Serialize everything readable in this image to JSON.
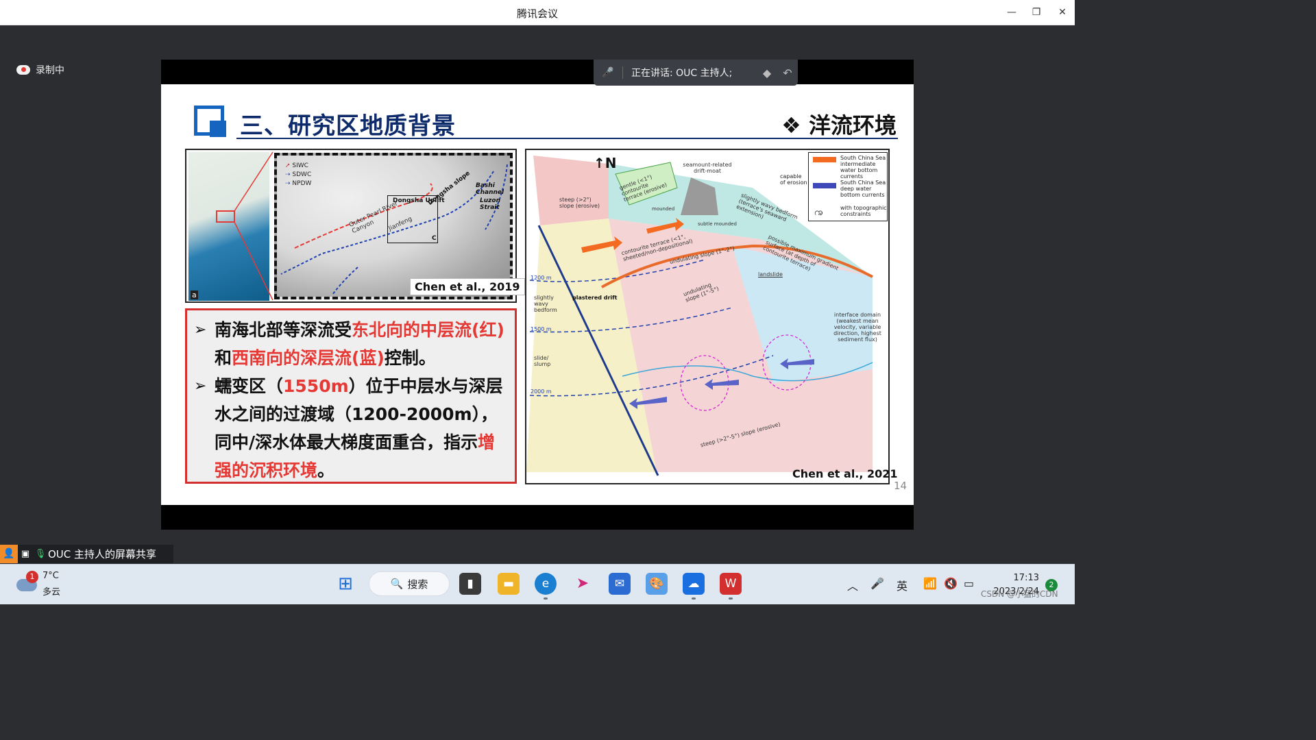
{
  "window": {
    "title": "腾讯会议",
    "minimize": "—",
    "restore": "❐",
    "close": "✕"
  },
  "recording": {
    "label": "录制中"
  },
  "speaker_bar": {
    "text": "正在讲话: OUC 主持人;"
  },
  "slide": {
    "title": "三、研究区地质背景",
    "subtitle": "❖ 洋流环境",
    "page_number": "14",
    "map": {
      "inset_label": "a",
      "legend": [
        "SIWC",
        "SDWC",
        "NPDW"
      ],
      "labels": [
        "Dongsha Uplift",
        "Dongsha slope",
        "Bashi Channel",
        "Luzon Strait",
        "Outer Pearl River Canyon",
        "Jianfeng",
        "C"
      ],
      "citation": "Chen et al., 2019"
    },
    "bullets": [
      {
        "parts": [
          {
            "text": "南海北部等深流受",
            "red": false
          },
          {
            "text": "东北向的中层流(红)",
            "red": true
          },
          {
            "text": "和",
            "red": false
          },
          {
            "text": "西南向的深层流(蓝)",
            "red": true
          },
          {
            "text": "控制。",
            "red": false
          }
        ]
      },
      {
        "parts": [
          {
            "text": "蠕变区（",
            "red": false
          },
          {
            "text": "1550m",
            "red": true
          },
          {
            "text": "）位于中层水与深层水之间的过渡域（1200-2000m），同中/深水体最大梯度面重合，指示",
            "red": false
          },
          {
            "text": "增强的沉积环境",
            "red": true
          },
          {
            "text": "。",
            "red": false
          }
        ]
      }
    ],
    "diagram": {
      "citation": "Chen et al., 2021",
      "north": "N",
      "legend": [
        "South China Sea intermediate water bottom currents",
        "South China Sea deep water bottom currents",
        "with topographic constraints"
      ],
      "capable": "capable of erosion",
      "labels": [
        "steep (>2°) slope (erosive)",
        "gentle (<1°) contourite terrace (erosive)",
        "seamount-related drift-moat",
        "mounded",
        "subtle mounded",
        "slightly wavy bedform (terrace's seaward extension)",
        "contourite terrace (<1°, sheeted/non-depositional)",
        "undulating slope (1°-2°)",
        "possible maximum gradient surface (at depth of contourite terrace)",
        "landslide",
        "plastered drift",
        "slightly wavy bedform",
        "undulating slope (1°-5°)",
        "interface domain (weakest mean velocity, variable direction, highest sediment flux)",
        "slide/ slump",
        "steep (>2°-5°) slope (erosive)",
        "1200 m",
        "1500 m",
        "2000 m"
      ]
    }
  },
  "share_bar": {
    "text": "OUC 主持人的屏幕共享"
  },
  "taskbar": {
    "weather_temp": "7°C",
    "weather_desc": "多云",
    "weather_badge": "1",
    "search": "搜索",
    "ime": "英",
    "time": "17:13",
    "date": "2023/2/24",
    "notifications": "2",
    "watermark": "CSDN @小猛的CDN"
  },
  "colors": {
    "accent_blue": "#1565c0",
    "title_navy": "#0d2a6b",
    "highlight_red": "#e53935",
    "box_red": "#d32f2f"
  }
}
